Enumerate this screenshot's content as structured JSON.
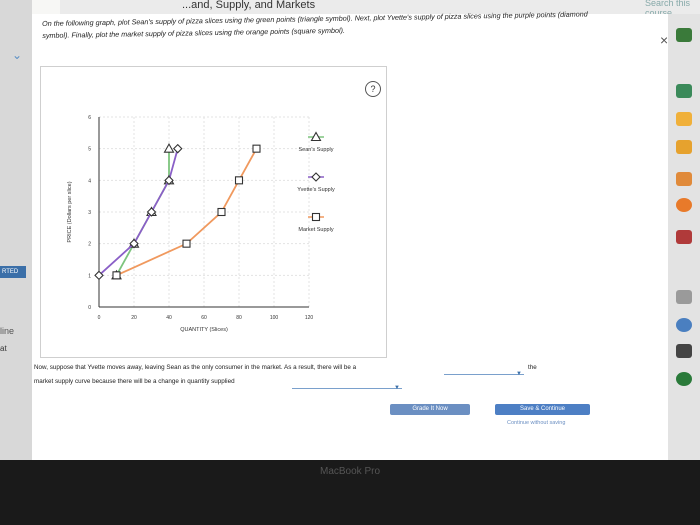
{
  "topbar": {
    "title": "...and, Supply, and Markets",
    "search": "Search this course"
  },
  "left_labels": {
    "tag1": "RTED",
    "tag2": "line",
    "tag3": "at"
  },
  "instructions": "On the following graph, plot Sean's supply of pizza slices using the green points (triangle symbol). Next, plot Yvette's supply of pizza slices using the purple points (diamond symbol). Finally, plot the market supply of pizza slices using the orange points (square symbol).",
  "help_label": "?",
  "close_label": "×",
  "chart_data": {
    "type": "line",
    "xlabel": "QUANTITY (Slices)",
    "ylabel": "PRICE (Dollars per slice)",
    "xlim": [
      0,
      120
    ],
    "ylim": [
      0,
      6
    ],
    "x_ticks": [
      "0",
      "20",
      "40",
      "60",
      "80",
      "100",
      "120"
    ],
    "y_ticks": [
      "0",
      "1",
      "2",
      "3",
      "4",
      "5",
      "6"
    ],
    "series": [
      {
        "name": "Sean's Supply",
        "color": "#7dc47d",
        "marker": "triangle",
        "points": [
          [
            10,
            1
          ],
          [
            20,
            2
          ],
          [
            30,
            3
          ],
          [
            40,
            4
          ],
          [
            40,
            5
          ]
        ]
      },
      {
        "name": "Yvette's Supply",
        "color": "#8a5fc7",
        "marker": "diamond",
        "points": [
          [
            0,
            1
          ],
          [
            20,
            2
          ],
          [
            30,
            3
          ],
          [
            40,
            4
          ],
          [
            45,
            5
          ]
        ]
      },
      {
        "name": "Market Supply",
        "color": "#f0995e",
        "marker": "square",
        "points": [
          [
            10,
            1
          ],
          [
            50,
            2
          ],
          [
            70,
            3
          ],
          [
            80,
            4
          ],
          [
            90,
            5
          ]
        ]
      }
    ]
  },
  "question": {
    "line1": "Now, suppose that Yvette moves away, leaving Sean as the only consumer in the market. As a result, there will be a",
    "after_dropdown1": "the",
    "line2": "market supply curve because there will be a change in quantity supplied",
    "dropdown1_value": "",
    "dropdown2_value": ""
  },
  "buttons": {
    "grade": "Grade It Now",
    "save": "Save & Continue",
    "continue_link": "Continue without saving"
  },
  "footer": {
    "label": "MacBook Pro"
  }
}
